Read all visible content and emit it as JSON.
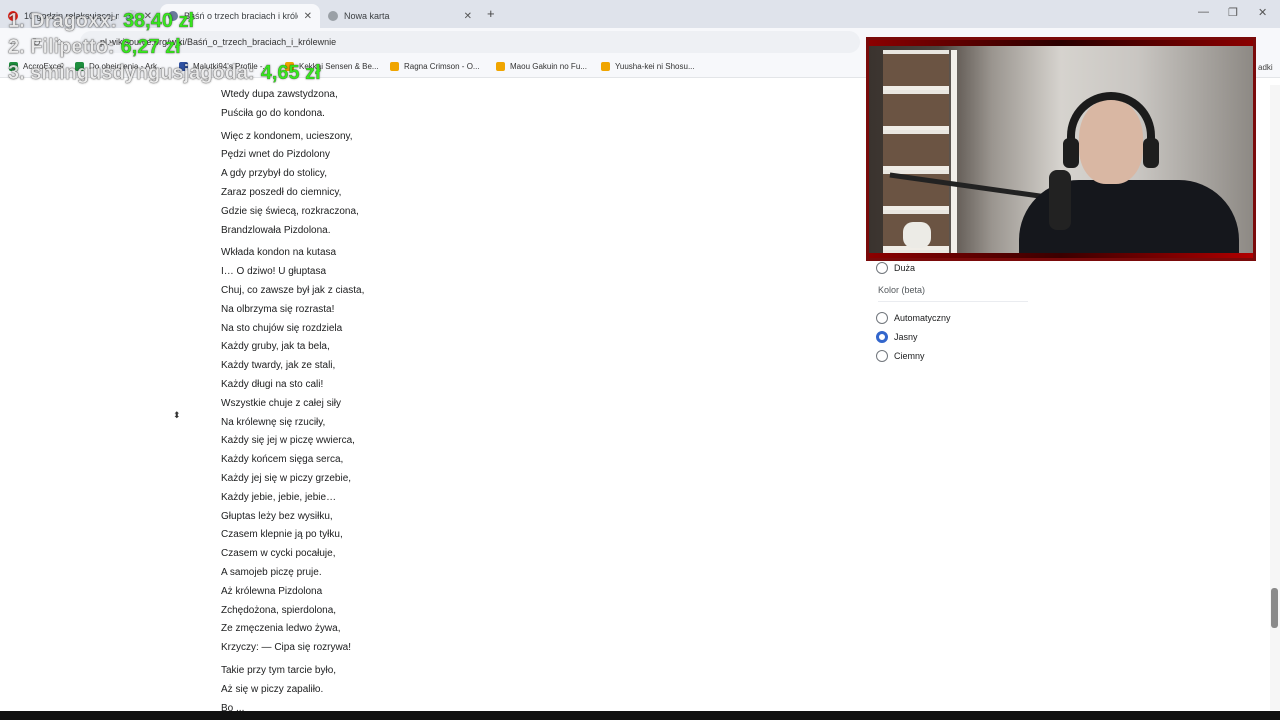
{
  "tabs": [
    {
      "title": "10 godzin relaksującej muz",
      "active": false
    },
    {
      "title": "Baśń o trzech braciach i królewn",
      "active": true
    },
    {
      "title": "Nowa karta",
      "active": false
    }
  ],
  "address": {
    "url": "pl.wikisource.org/wiki/Baśń_o_trzech_braciach_i_królewnie"
  },
  "bookmarks": [
    {
      "label": "AccroExcel"
    },
    {
      "label": "Do obejrzenia - Ark..."
    },
    {
      "label": "Malutki94's Profile -..."
    },
    {
      "label": "Kekkai Sensen & Be..."
    },
    {
      "label": "Ragna Crimson - O..."
    },
    {
      "label": "Maou Gakuin no Fu..."
    },
    {
      "label": "Yuusha-kei ni Shosu..."
    }
  ],
  "bookmarks_right": "adki",
  "donations": [
    {
      "name": "1. Dragoxx:",
      "amount": "38,40 zł"
    },
    {
      "name": "2. Filipetto:",
      "amount": "6,27 zł"
    },
    {
      "name": "3. smingusdyngusjagoda:",
      "amount": "4,65 zł"
    }
  ],
  "poem": {
    "stanza1": [
      "Wtedy dupa zawstydzona,",
      "Puściła go do kondona."
    ],
    "stanza2": [
      "Więc z kondonem, ucieszony,",
      "Pędzi wnet do Pizdolony",
      "A gdy przybył do stolicy,",
      "Zaraz poszedł do ciemnicy,",
      "Gdzie się świecą, rozkraczona,",
      "Brandzlowała Pizdolona."
    ],
    "stanza3": [
      "Wkłada kondon na kutasa",
      "I… O dziwo! U głuptasa",
      "Chuj, co zawsze był jak z ciasta,",
      "Na olbrzyma się rozrasta!",
      "Na sto chujów się rozdziela",
      "Każdy gruby, jak ta bela,",
      "Każdy twardy, jak ze stali,",
      "Każdy długi na sto cali!",
      "Wszystkie chuje z całej siły",
      "Na królewnę się rzuciły,",
      "Każdy się jej w piczę wwierca,",
      "Każdy końcem sięga serca,",
      "Każdy jej się w piczy grzebie,",
      "Każdy jebie, jebie, jebie…",
      "Głuptas leży bez wysiłku,",
      "Czasem klepnie ją po tyłku,",
      "Czasem w cycki pocałuje,",
      "A samojeb piczę pruje.",
      "Aż królewna Pizdolona",
      "Zchędożona, spierdolona,",
      "Ze zmęczenia ledwo żywa,",
      "Krzyczy: — Cipa się rozrywa!"
    ],
    "stanza4": [
      "Takie przy tym tarcie było,",
      "Aż się w piczy zapaliło.",
      "Bo ..."
    ]
  },
  "settings": {
    "size_option": "Duża",
    "color_title": "Kolor (beta)",
    "color_options": [
      {
        "label": "Automatyczny",
        "selected": false
      },
      {
        "label": "Jasny",
        "selected": true
      },
      {
        "label": "Ciemny",
        "selected": false
      }
    ]
  }
}
